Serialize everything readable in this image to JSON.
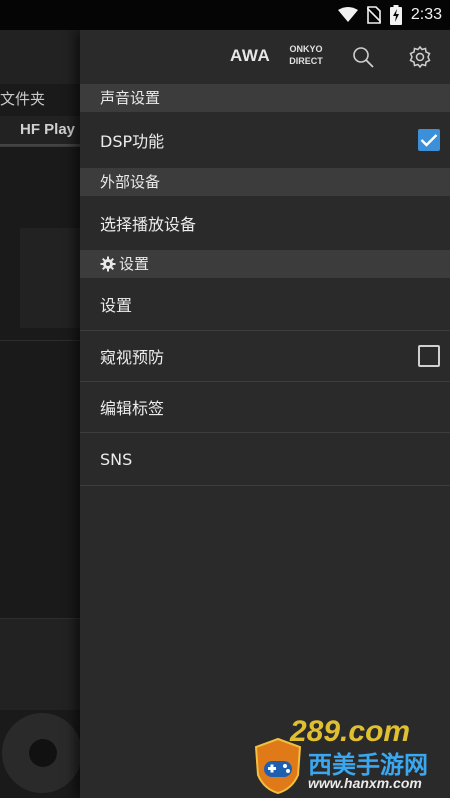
{
  "status_bar": {
    "time": "2:33",
    "icons": [
      "wifi-icon",
      "no-sim-icon",
      "battery-charging-icon"
    ]
  },
  "background_app": {
    "folder_label": "文件夹",
    "tab_label": "HF Play"
  },
  "drawer": {
    "toolbar": {
      "awa_label": "AWA",
      "onkyo_line1": "ONKYO",
      "onkyo_line2": "DIRECT",
      "icons": [
        "search-icon",
        "gear-icon"
      ]
    },
    "sections": [
      {
        "header": "声音设置",
        "items": [
          {
            "label": "DSP功能",
            "checkbox": true
          }
        ]
      },
      {
        "header": "外部设备",
        "items": [
          {
            "label": "选择播放设备"
          }
        ]
      },
      {
        "header": "设置",
        "header_icon": "gear-icon",
        "items": [
          {
            "label": "设置"
          },
          {
            "label": "窥视预防",
            "checkbox": false
          },
          {
            "label": "编辑标签"
          },
          {
            "label": "SNS"
          }
        ]
      }
    ]
  },
  "watermark": {
    "number": "289.com",
    "title": "西美手游网",
    "url": "www.hanxm.com"
  },
  "colors": {
    "accent": "#3b90d9",
    "drawer_bg": "#2a2a2a",
    "header_bg": "#3c3c3c"
  }
}
